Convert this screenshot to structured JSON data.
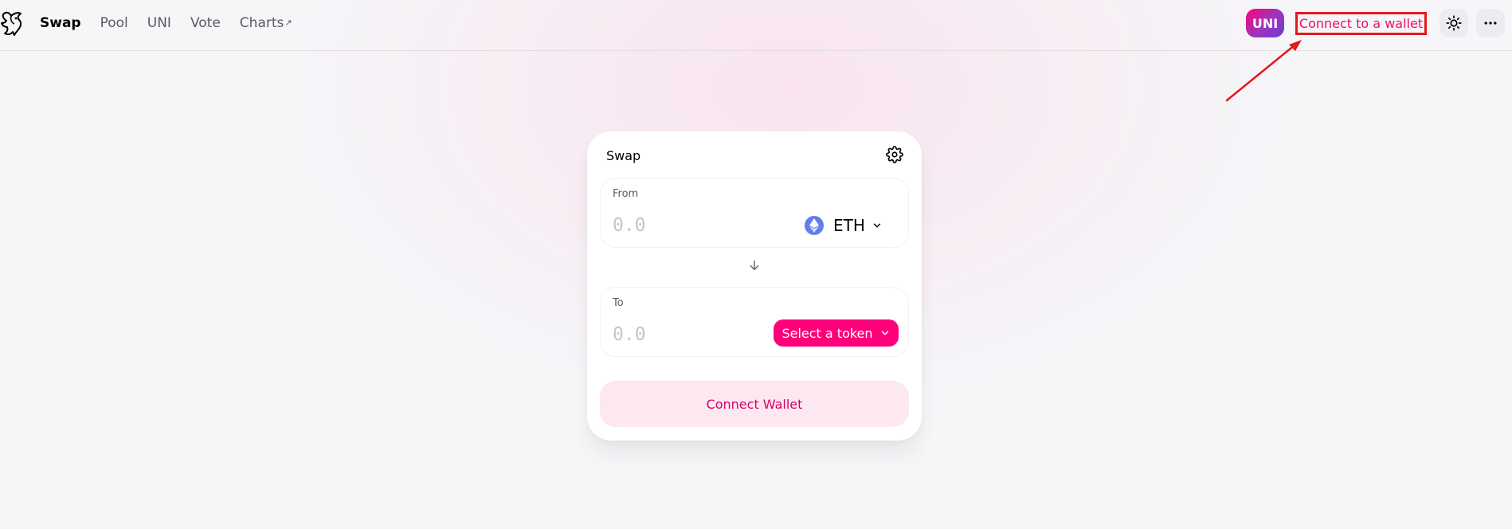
{
  "nav": {
    "items": [
      {
        "label": "Swap",
        "active": true
      },
      {
        "label": "Pool",
        "active": false
      },
      {
        "label": "UNI",
        "active": false
      },
      {
        "label": "Vote",
        "active": false
      },
      {
        "label": "Charts",
        "active": false,
        "external_marker": "↗"
      }
    ]
  },
  "header": {
    "uni_badge": "UNI",
    "connect_label": "Connect to a wallet",
    "theme_icon": "sun-icon",
    "more_icon": "more-horizontal-icon"
  },
  "swap": {
    "title": "Swap",
    "settings_icon": "gear-icon",
    "from": {
      "label": "From",
      "placeholder": "0.0",
      "value": "",
      "token_symbol": "ETH",
      "token_icon": "eth-icon"
    },
    "to": {
      "label": "To",
      "placeholder": "0.0",
      "value": "",
      "select_label": "Select a token"
    },
    "switch_icon": "arrow-down-icon",
    "connect_wallet_label": "Connect Wallet"
  },
  "colors": {
    "accent": "#ff007a",
    "accent_text": "#d50066",
    "annotation": "#e21a1a",
    "connect_button_bg": "#fde8f1",
    "eth": "#627eea"
  }
}
